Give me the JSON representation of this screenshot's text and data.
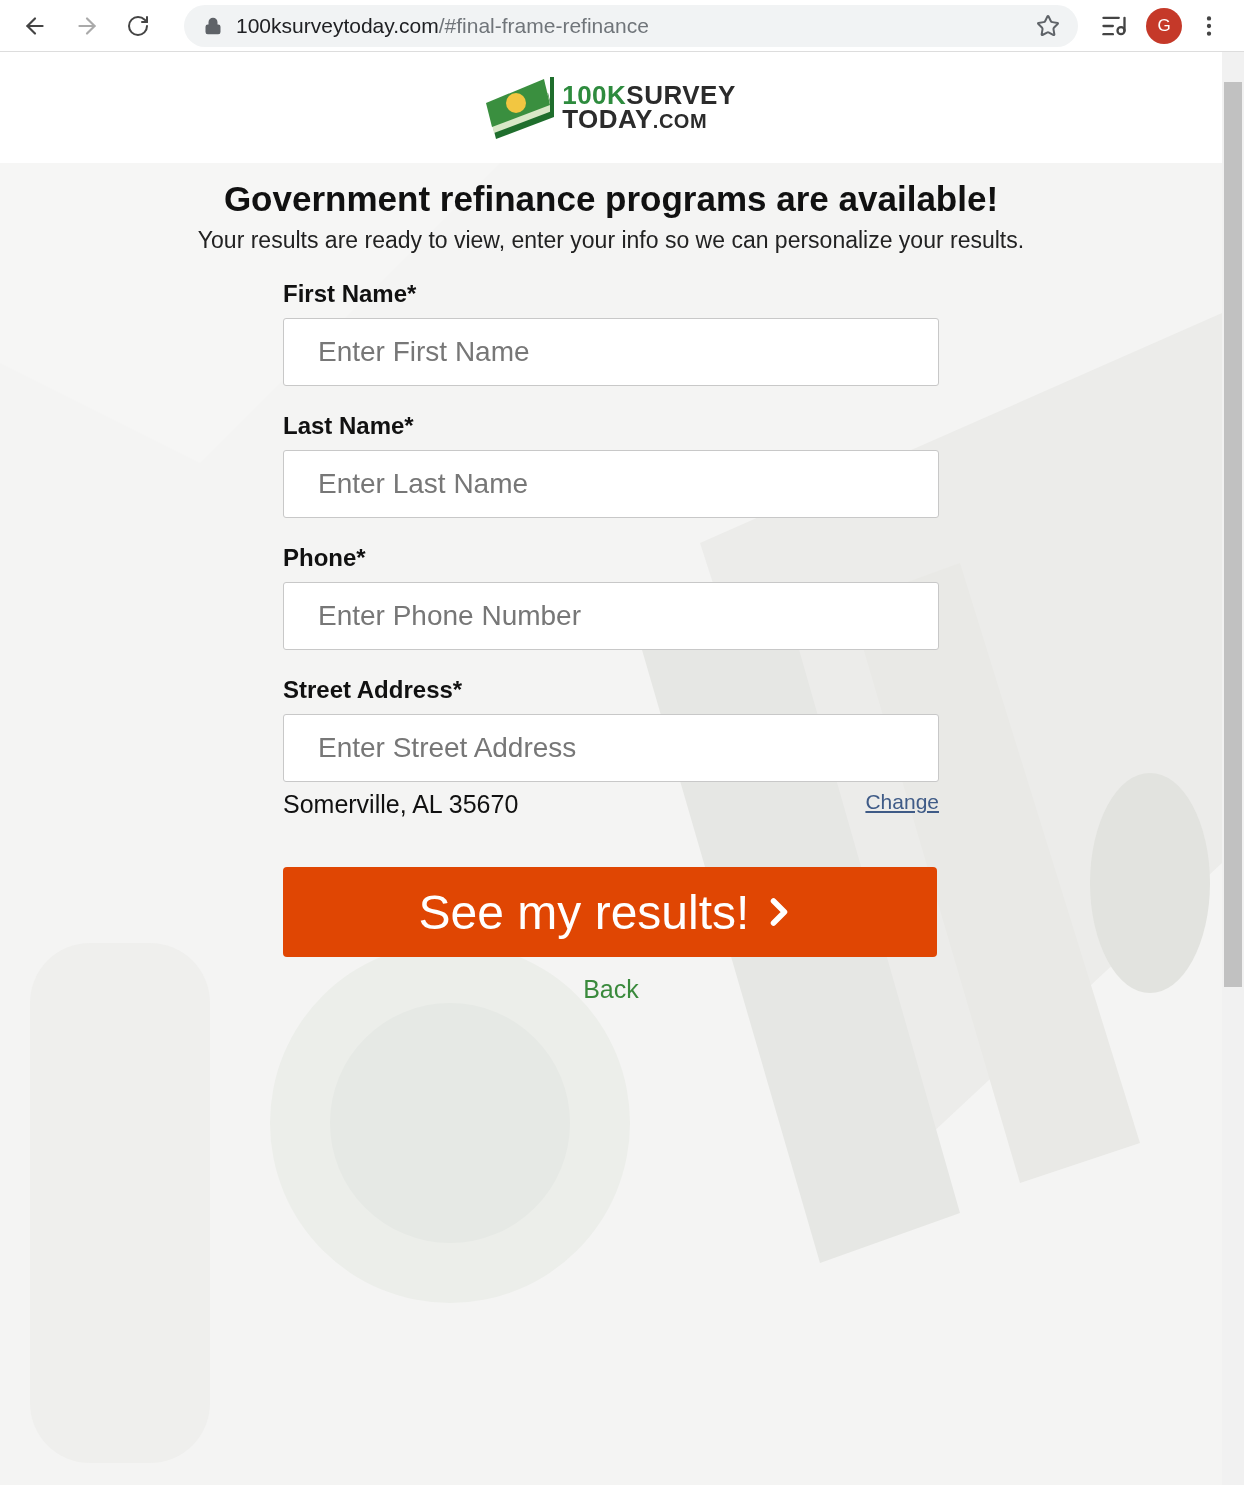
{
  "browser": {
    "url_domain": "100ksurveytoday.com",
    "url_path": "/#final-frame-refinance",
    "avatar": "G"
  },
  "logo": {
    "accent": "100K",
    "line1": "SURVEY",
    "line2": "TODAY",
    "suffix": ".COM"
  },
  "heading": "Government refinance programs are available!",
  "subheading": "Your results are ready to view, enter your info so we can personalize your results.",
  "fields": [
    {
      "label": "First Name*",
      "placeholder": "Enter First Name"
    },
    {
      "label": "Last Name*",
      "placeholder": "Enter Last Name"
    },
    {
      "label": "Phone*",
      "placeholder": "Enter Phone Number"
    },
    {
      "label": "Street Address*",
      "placeholder": "Enter Street Address"
    }
  ],
  "location": "Somerville, AL 35670",
  "change_link": "Change",
  "submit": "See my results!",
  "back_link": "Back"
}
